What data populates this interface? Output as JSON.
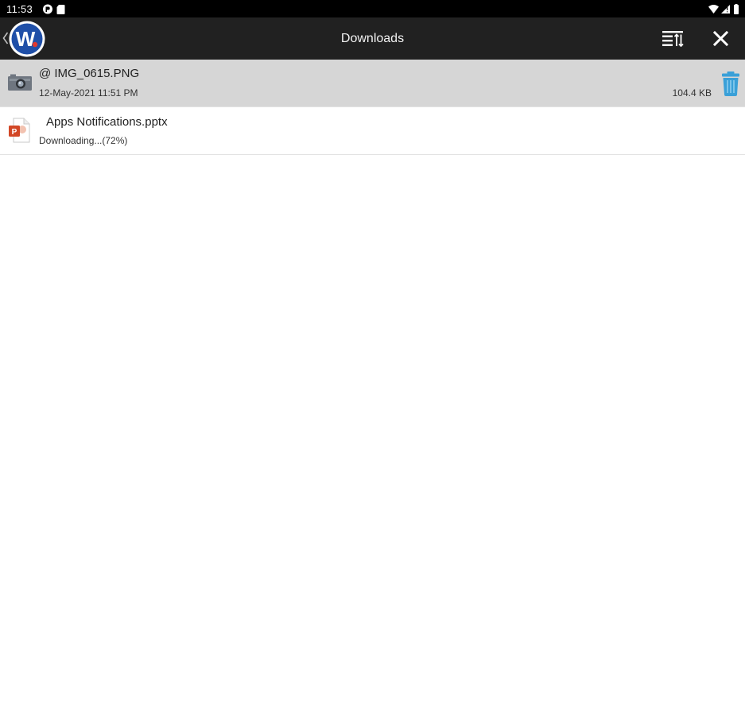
{
  "status_bar": {
    "time": "11:53",
    "left_icons": [
      "app-notification-icon",
      "sd-card-icon"
    ],
    "right_icons": [
      "wifi-icon",
      "signal-icon",
      "battery-icon"
    ]
  },
  "app_bar": {
    "title": "Downloads",
    "logo_letter": "W",
    "brand_color": "#1f4fa8",
    "icons": [
      "back-chevron-icon",
      "app-logo",
      "sort-filter-icon",
      "close-icon"
    ]
  },
  "downloads": [
    {
      "name": "@ IMG_0615.PNG",
      "subtitle": "12-May-2021 11:51 PM",
      "size": "104.4 KB",
      "icon": "camera-image-icon",
      "selected": true,
      "action_icon": "trash-icon",
      "action_color": "#3aa0d8"
    },
    {
      "name": "Apps Notifications.pptx",
      "subtitle": "Downloading...(72%)",
      "progress": 0.72,
      "icon": "powerpoint-file-icon",
      "selected": false
    }
  ]
}
